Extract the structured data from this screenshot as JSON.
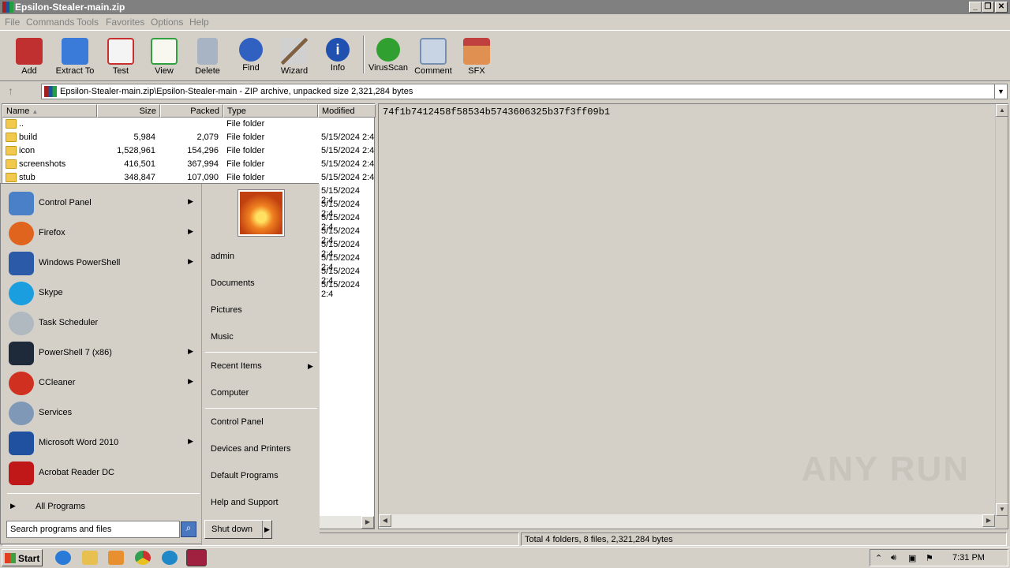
{
  "window": {
    "title": "Epsilon-Stealer-main.zip"
  },
  "menu": [
    "File",
    "Commands",
    "Tools",
    "Favorites",
    "Options",
    "Help"
  ],
  "toolbar": [
    {
      "label": "Add",
      "icon": "add-archive-icon",
      "color": "#c03030"
    },
    {
      "label": "Extract To",
      "icon": "extract-folder-icon",
      "color": "#3a7ad8"
    },
    {
      "label": "Test",
      "icon": "test-clipboard-icon",
      "color": "#c83030"
    },
    {
      "label": "View",
      "icon": "view-book-icon",
      "color": "#30a040"
    },
    {
      "label": "Delete",
      "icon": "trash-icon",
      "color": "#8090a8"
    },
    {
      "label": "Find",
      "icon": "magnifier-icon",
      "color": "#3060c0"
    },
    {
      "label": "Wizard",
      "icon": "wand-icon",
      "color": "#a0a0a0"
    },
    {
      "label": "Info",
      "icon": "info-icon",
      "color": "#2050b0"
    },
    {
      "label": "VirusScan",
      "icon": "virus-scan-icon",
      "color": "#30a030"
    },
    {
      "label": "Comment",
      "icon": "comment-icon",
      "color": "#7890b0"
    },
    {
      "label": "SFX",
      "icon": "sfx-box-icon",
      "color": "#e07030"
    }
  ],
  "address": {
    "path": "Epsilon-Stealer-main.zip\\Epsilon-Stealer-main - ZIP archive, unpacked size 2,321,284 bytes"
  },
  "columns": {
    "name": "Name",
    "size": "Size",
    "packed": "Packed",
    "type": "Type",
    "modified": "Modified"
  },
  "files": [
    {
      "name": "..",
      "size": "",
      "packed": "",
      "type": "File folder",
      "modified": ""
    },
    {
      "name": "build",
      "size": "5,984",
      "packed": "2,079",
      "type": "File folder",
      "modified": "5/15/2024 2:4"
    },
    {
      "name": "icon",
      "size": "1,528,961",
      "packed": "154,296",
      "type": "File folder",
      "modified": "5/15/2024 2:4"
    },
    {
      "name": "screenshots",
      "size": "416,501",
      "packed": "367,994",
      "type": "File folder",
      "modified": "5/15/2024 2:4"
    },
    {
      "name": "stub",
      "size": "348,847",
      "packed": "107,090",
      "type": "File folder",
      "modified": "5/15/2024 2:4"
    }
  ],
  "hidden_modified": [
    "5/15/2024 2:4",
    "5/15/2024 2:4",
    "5/15/2024 2:4",
    "5/15/2024 2:4",
    "5/15/2024 2:4",
    "5/15/2024 2:4",
    "5/15/2024 2:4",
    "5/15/2024 2:4"
  ],
  "viewer": {
    "text": "74f1b7412458f58534b5743606325b37f3ff09b1"
  },
  "watermark": "ANY RUN",
  "status": {
    "total": "Total 4 folders, 8 files, 2,321,284 bytes"
  },
  "startmenu": {
    "programs": [
      {
        "label": "Control Panel",
        "icon": "control-panel-icon",
        "color": "#4a80c8",
        "arrow": true
      },
      {
        "label": "Firefox",
        "icon": "firefox-icon",
        "color": "#e0641e",
        "arrow": true
      },
      {
        "label": "Windows PowerShell",
        "icon": "powershell-icon",
        "color": "#2a5aa8",
        "arrow": true
      },
      {
        "label": "Skype",
        "icon": "skype-icon",
        "color": "#1a9ee0",
        "arrow": false
      },
      {
        "label": "Task Scheduler",
        "icon": "clock-icon",
        "color": "#b0b8c0",
        "arrow": false
      },
      {
        "label": "PowerShell 7 (x86)",
        "icon": "powershell7-icon",
        "color": "#1e2a3a",
        "arrow": true
      },
      {
        "label": "CCleaner",
        "icon": "ccleaner-icon",
        "color": "#d03020",
        "arrow": true
      },
      {
        "label": "Services",
        "icon": "gears-icon",
        "color": "#8098b8",
        "arrow": false
      },
      {
        "label": "Microsoft Word 2010",
        "icon": "word-icon",
        "color": "#2050a0",
        "arrow": true
      },
      {
        "label": "Acrobat Reader DC",
        "icon": "acrobat-icon",
        "color": "#c01818",
        "arrow": false
      }
    ],
    "all_programs": "All Programs",
    "search_placeholder": "Search programs and files",
    "right": [
      "admin",
      "Documents",
      "Pictures",
      "Music",
      "Recent Items",
      "Computer",
      "Control Panel",
      "Devices and Printers",
      "Default Programs",
      "Help and Support"
    ],
    "shutdown": "Shut down"
  },
  "taskbar": {
    "start": "Start",
    "apps": [
      {
        "icon": "ie-icon",
        "color": "#2a7ad8"
      },
      {
        "icon": "explorer-folder-icon",
        "color": "#e8c050"
      },
      {
        "icon": "media-player-icon",
        "color": "#e89030"
      },
      {
        "icon": "chrome-icon",
        "color": "#30a050"
      },
      {
        "icon": "edge-icon",
        "color": "#1e88c8"
      },
      {
        "icon": "winrar-icon",
        "color": "#a02040"
      }
    ],
    "clock": "7:31 PM"
  }
}
